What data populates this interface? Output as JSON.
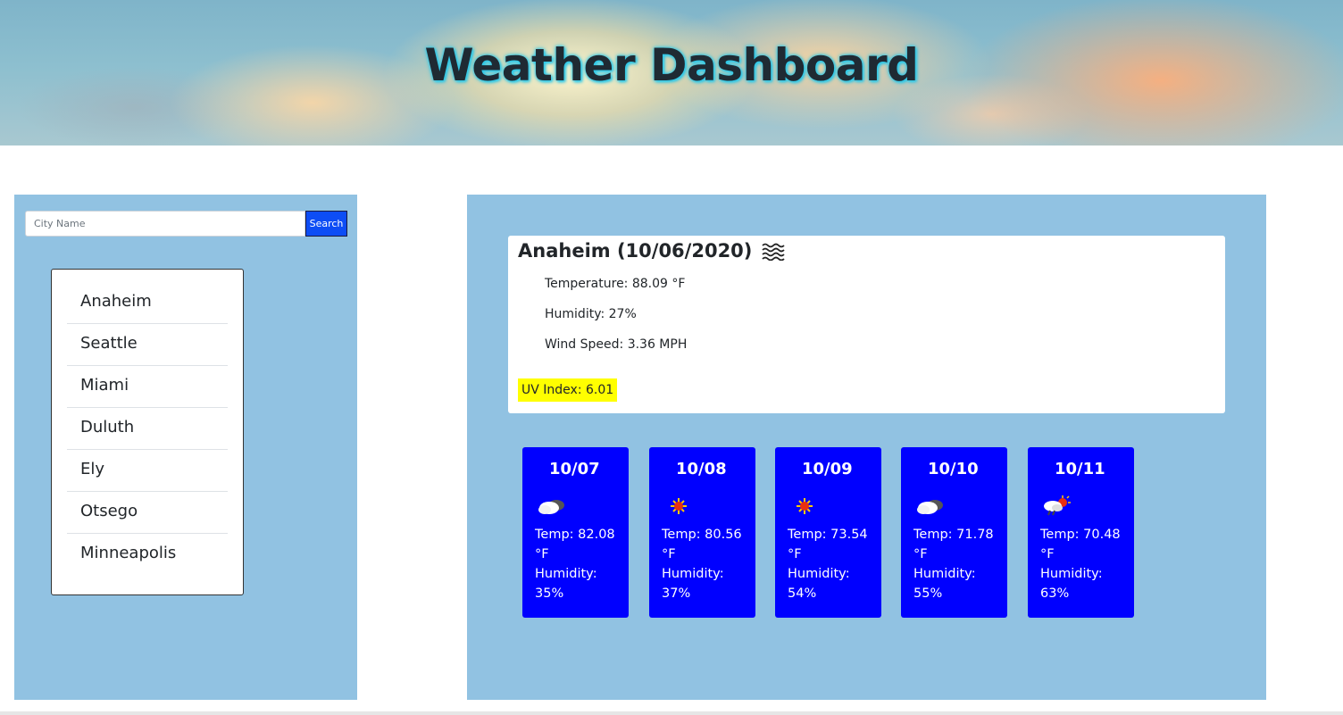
{
  "header": {
    "title": "Weather Dashboard"
  },
  "search": {
    "placeholder": "City Name",
    "value": "",
    "button_label": "Search"
  },
  "history": {
    "cities": [
      "Anaheim",
      "Seattle",
      "Miami",
      "Duluth",
      "Ely",
      "Otsego",
      "Minneapolis"
    ]
  },
  "current": {
    "title": "Anaheim (10/06/2020)",
    "icon": "haze-wind-icon",
    "temperature": "Temperature: 88.09 °F",
    "humidity": "Humidity: 27%",
    "wind": "Wind Speed: 3.36 MPH",
    "uv": "UV Index: 6.01"
  },
  "forecast": [
    {
      "date": "10/07",
      "icon": "cloudy-icon",
      "temp": "Temp: 82.08 °F",
      "humidity": "Humidity: 35%"
    },
    {
      "date": "10/08",
      "icon": "sun-icon",
      "temp": "Temp: 80.56 °F",
      "humidity": "Humidity: 37%"
    },
    {
      "date": "10/09",
      "icon": "sun-icon",
      "temp": "Temp: 73.54 °F",
      "humidity": "Humidity: 54%"
    },
    {
      "date": "10/10",
      "icon": "cloudy-icon",
      "temp": "Temp: 71.78 °F",
      "humidity": "Humidity: 55%"
    },
    {
      "date": "10/11",
      "icon": "rain-sun-icon",
      "temp": "Temp: 70.48 °F",
      "humidity": "Humidity: 63%"
    }
  ],
  "colors": {
    "panel": "#91c2e2",
    "forecast_card": "#0000ff",
    "uv_highlight": "#ffff00",
    "search_button": "#0d4df5"
  }
}
